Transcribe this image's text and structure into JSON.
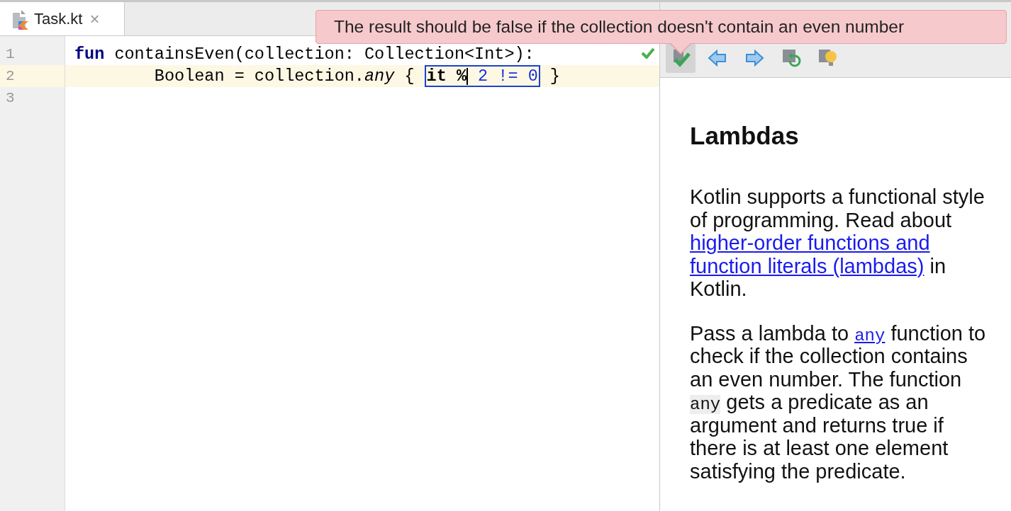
{
  "tab": {
    "label": "Task.kt",
    "close": "×",
    "selected": true
  },
  "editor": {
    "lines": [
      {
        "number": "1",
        "current": false,
        "passed": true,
        "tokens": [
          {
            "kind": "keyword",
            "text": "fun"
          },
          {
            "kind": "plain",
            "text": " containsEven(collection: Collection<Int>):"
          }
        ]
      },
      {
        "number": "2",
        "current": true,
        "passed": false,
        "tokens": [
          {
            "kind": "plain",
            "text": "        Boolean = collection."
          },
          {
            "kind": "italic",
            "text": "any"
          },
          {
            "kind": "plain",
            "text": " { "
          },
          {
            "kind": "answer",
            "parts": [
              {
                "kind": "bold",
                "text": "it %"
              },
              {
                "kind": "cursor"
              },
              {
                "kind": "number",
                "text": " 2 != 0"
              }
            ]
          },
          {
            "kind": "plain",
            "text": " }"
          }
        ]
      },
      {
        "number": "3",
        "current": false,
        "passed": false
      }
    ]
  },
  "tooltip": {
    "text": "The result should be false if the collection doesn't contain an even number"
  },
  "toolbar": {
    "buttons": [
      {
        "kind": "check",
        "selected": true
      },
      {
        "kind": "previous",
        "selected": false
      },
      {
        "kind": "next",
        "selected": false
      },
      {
        "kind": "reset",
        "selected": false
      },
      {
        "kind": "hint",
        "selected": false
      }
    ]
  },
  "description": {
    "title": "Lambdas",
    "paragraphs": [
      [
        {
          "kind": "text",
          "text": "Kotlin supports a functional style of programming. Read about "
        },
        {
          "kind": "link",
          "text": "higher-order functions and"
        },
        {
          "kind": "link",
          "text": "function literals (lambdas)"
        },
        {
          "kind": "text",
          "text": " in Kotlin."
        }
      ],
      [
        {
          "kind": "text",
          "text": "Pass a lambda to "
        },
        {
          "kind": "code_link",
          "text": "any"
        },
        {
          "kind": "text",
          "text": " function to check if the collection contains an even number. The function "
        },
        {
          "kind": "code",
          "text": "any"
        },
        {
          "kind": "text",
          "text": " gets a predicate as an argument and returns true if there is at least one element satisfying the predicate."
        }
      ]
    ]
  }
}
